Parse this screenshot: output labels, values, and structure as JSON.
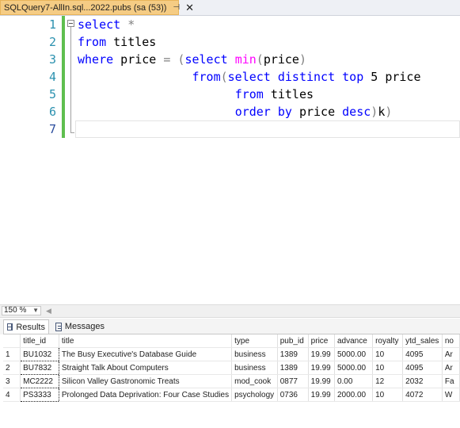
{
  "tab": {
    "title": "SQLQuery7-AllIn.sql...2022.pubs (sa (53))",
    "pin_glyph": "⊣",
    "close_glyph": "✕"
  },
  "editor": {
    "line_numbers": [
      "1",
      "2",
      "3",
      "4",
      "5",
      "6",
      "7"
    ],
    "lines": [
      [
        {
          "t": "select",
          "c": "kw"
        },
        {
          "t": " *",
          "c": "op"
        }
      ],
      [
        {
          "t": "from",
          "c": "kw"
        },
        {
          "t": " titles",
          "c": "id"
        }
      ],
      [
        {
          "t": "where",
          "c": "kw"
        },
        {
          "t": " price ",
          "c": "id"
        },
        {
          "t": "=",
          "c": "op"
        },
        {
          "t": " (",
          "c": "op"
        },
        {
          "t": "select",
          "c": "kw"
        },
        {
          "t": " ",
          "c": "id"
        },
        {
          "t": "min",
          "c": "fn"
        },
        {
          "t": "(",
          "c": "op"
        },
        {
          "t": "price",
          "c": "id"
        },
        {
          "t": ")",
          "c": "op"
        }
      ],
      [
        {
          "t": "                ",
          "c": "id"
        },
        {
          "t": "from",
          "c": "kw"
        },
        {
          "t": "(",
          "c": "op"
        },
        {
          "t": "select",
          "c": "kw"
        },
        {
          "t": " ",
          "c": "id"
        },
        {
          "t": "distinct",
          "c": "kw"
        },
        {
          "t": " ",
          "c": "id"
        },
        {
          "t": "top",
          "c": "kw"
        },
        {
          "t": " 5 price",
          "c": "id"
        }
      ],
      [
        {
          "t": "                      ",
          "c": "id"
        },
        {
          "t": "from",
          "c": "kw"
        },
        {
          "t": " titles",
          "c": "id"
        }
      ],
      [
        {
          "t": "                      ",
          "c": "id"
        },
        {
          "t": "order",
          "c": "kw"
        },
        {
          "t": " ",
          "c": "id"
        },
        {
          "t": "by",
          "c": "kw"
        },
        {
          "t": " price ",
          "c": "id"
        },
        {
          "t": "desc",
          "c": "kw"
        },
        {
          "t": ")",
          "c": "op"
        },
        {
          "t": "k",
          "c": "id"
        },
        {
          "t": ")",
          "c": "op"
        }
      ],
      []
    ]
  },
  "zoom": {
    "value": "150 %"
  },
  "results_tabs": {
    "results_label": "Results",
    "messages_label": "Messages"
  },
  "grid": {
    "columns": [
      "title_id",
      "title",
      "type",
      "pub_id",
      "price",
      "advance",
      "royalty",
      "ytd_sales",
      "no"
    ],
    "rows": [
      {
        "n": "1",
        "cells": [
          "BU1032",
          "The Busy Executive's Database Guide",
          "business",
          "1389",
          "19.99",
          "5000.00",
          "10",
          "4095",
          "Ar"
        ]
      },
      {
        "n": "2",
        "cells": [
          "BU7832",
          "Straight Talk About Computers",
          "business",
          "1389",
          "19.99",
          "5000.00",
          "10",
          "4095",
          "Ar"
        ]
      },
      {
        "n": "3",
        "cells": [
          "MC2222",
          "Silicon Valley Gastronomic Treats",
          "mod_cook",
          "0877",
          "19.99",
          "0.00",
          "12",
          "2032",
          "Fa"
        ]
      },
      {
        "n": "4",
        "cells": [
          "PS3333",
          "Prolonged Data Deprivation: Four Case Studies",
          "psychology",
          "0736",
          "19.99",
          "2000.00",
          "10",
          "4072",
          "W"
        ]
      }
    ]
  },
  "colors": {
    "keyword": "#0000ff",
    "function": "#ff00ff",
    "operator": "#808080",
    "line_number": "#2b91af",
    "tab_active": "#f5cc84",
    "change_bar": "#5fbf4f"
  }
}
